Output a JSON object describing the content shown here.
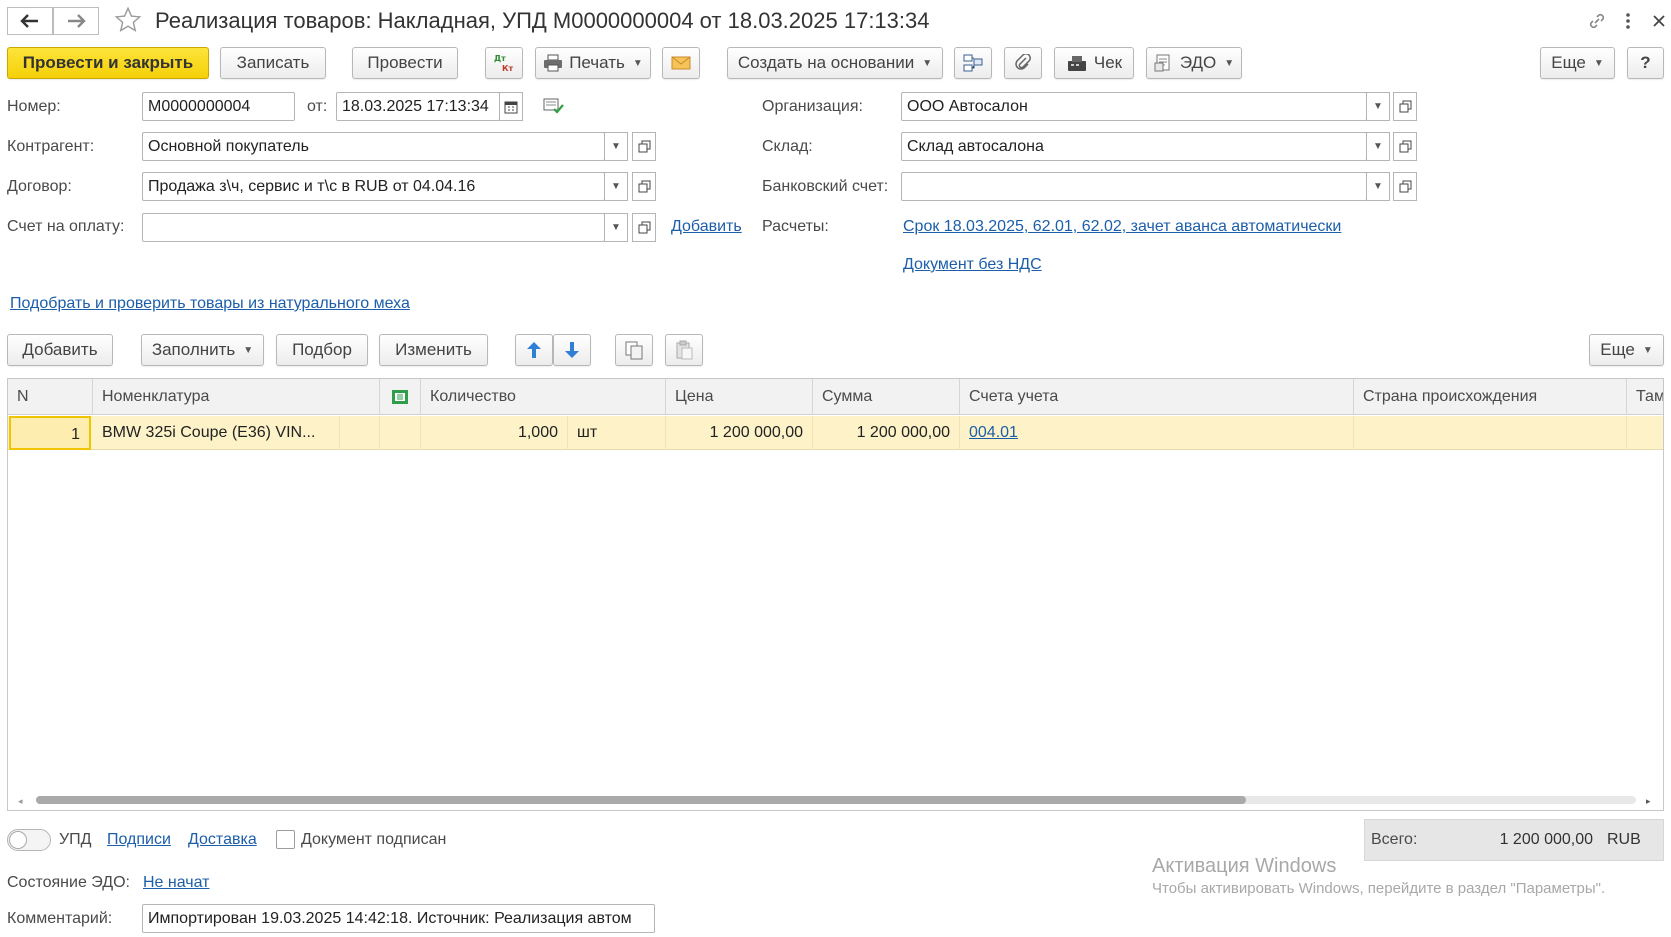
{
  "window": {
    "title": "Реализация товаров: Накладная, УПД М0000000004 от 18.03.2025 17:13:34"
  },
  "toolbar": {
    "post_close": "Провести и закрыть",
    "save": "Записать",
    "post": "Провести",
    "print": "Печать",
    "create_based": "Создать на основании",
    "receipt": "Чек",
    "edo": "ЭДО",
    "more": "Еще",
    "help": "?"
  },
  "form": {
    "number_label": "Номер:",
    "number_value": "М0000000004",
    "date_label": "от:",
    "date_value": "18.03.2025 17:13:34",
    "counterparty_label": "Контрагент:",
    "counterparty_value": "Основной покупатель",
    "contract_label": "Договор:",
    "contract_value": "Продажа з\\ч, сервис и т\\с в RUB от 04.04.16",
    "invoice_label": "Счет на оплату:",
    "invoice_value": "",
    "invoice_add": "Добавить",
    "org_label": "Организация:",
    "org_value": "ООО Автосалон",
    "warehouse_label": "Склад:",
    "warehouse_value": "Склад автосалона",
    "bank_label": "Банковский счет:",
    "bank_value": "",
    "settlements_label": "Расчеты:",
    "settlements_link": "Срок 18.03.2025, 62.01, 62.02, зачет аванса автоматически",
    "vat_link": "Документ без НДС",
    "fur_link": "Подобрать и проверить товары из натурального меха"
  },
  "table_toolbar": {
    "add": "Добавить",
    "fill": "Заполнить",
    "pick": "Подбор",
    "change": "Изменить",
    "more": "Еще"
  },
  "table": {
    "columns": [
      "N",
      "Номенклатура",
      "Количество",
      "Цена",
      "Сумма",
      "Счета учета",
      "Страна происхождения",
      "Там"
    ],
    "rows": [
      {
        "n": "1",
        "item": "BMW 325i Coupe (E36) VIN...",
        "qty": "1,000",
        "unit": "шт",
        "price": "1 200 000,00",
        "sum": "1 200 000,00",
        "account": "004.01",
        "country": ""
      }
    ]
  },
  "bottom": {
    "upd_label": "УПД",
    "signatures_link": "Подписи",
    "delivery_link": "Доставка",
    "signed_label": "Документ подписан",
    "edo_state_label": "Состояние ЭДО:",
    "edo_state_link": "Не начат",
    "comment_label": "Комментарий:",
    "comment_value": "Импортирован 19.03.2025 14:42:18. Источник: Реализация автом",
    "total_label": "Всего:",
    "total_value": "1 200 000,00",
    "currency": "RUB"
  },
  "watermark": {
    "line1": "Активация Windows",
    "line2": "Чтобы активировать Windows, перейдите в раздел \"Параметры\"."
  },
  "colors": {
    "primary_button": "#f5d009",
    "link": "#1c5eaa",
    "row_selected": "#fdf2c8"
  }
}
